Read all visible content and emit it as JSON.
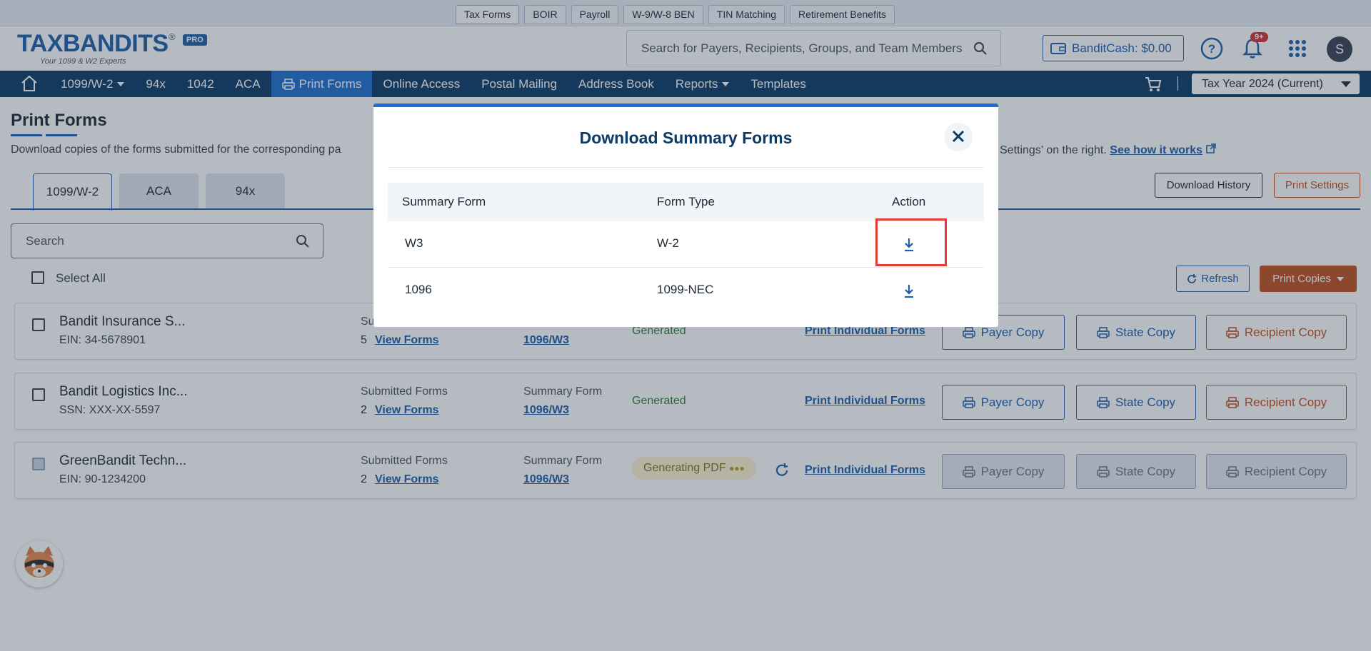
{
  "product_tabs": [
    "Tax Forms",
    "BOIR",
    "Payroll",
    "W-9/W-8 BEN",
    "TIN Matching",
    "Retirement Benefits"
  ],
  "logo": {
    "word": "TAXBANDITS",
    "tagline": "Your 1099 & W2 Experts",
    "badge": "PRO",
    "reg": "®"
  },
  "header": {
    "search_placeholder": "Search for Payers, Recipients, Groups, and Team Members",
    "bandit_cash": "BanditCash: $0.00",
    "notifications_badge": "9+",
    "avatar_initial": "S"
  },
  "nav": {
    "items": [
      "1099/W-2",
      "94x",
      "1042",
      "ACA",
      "Print Forms",
      "Online Access",
      "Postal Mailing",
      "Address Book",
      "Reports",
      "Templates"
    ],
    "tax_year": "Tax Year 2024 (Current)"
  },
  "page": {
    "title": "Print Forms",
    "description_left": "Download copies of the forms submitted for the corresponding pa",
    "description_right": "Settings' on the right.",
    "see_how": "See how it works",
    "form_tabs": [
      "1099/W-2",
      "ACA",
      "94x"
    ],
    "download_history": "Download History",
    "print_settings": "Print Settings",
    "search_placeholder": "Search",
    "select_all": "Select All",
    "refresh": "Refresh",
    "print_copies": "Print Copies"
  },
  "rows": [
    {
      "name": "Bandit Insurance S...",
      "id": "EIN: 34-5678901",
      "submitted_label": "Su",
      "count": "5",
      "view_forms": "View Forms",
      "summary_label": "",
      "summary_link": "1096/W3",
      "status": "Generated",
      "print_individual": "Print Individual Forms",
      "payer_copy": "Payer Copy",
      "state_copy": "State Copy",
      "recipient_copy": "Recipient Copy"
    },
    {
      "name": "Bandit Logistics Inc...",
      "id": "SSN: XXX-XX-5597",
      "submitted_label": "Submitted Forms",
      "count": "2",
      "view_forms": "View Forms",
      "summary_label": "Summary Form",
      "summary_link": "1096/W3",
      "status": "Generated",
      "print_individual": "Print Individual Forms",
      "payer_copy": "Payer Copy",
      "state_copy": "State Copy",
      "recipient_copy": "Recipient Copy"
    },
    {
      "name": "GreenBandit Techn...",
      "id": "EIN: 90-1234200",
      "submitted_label": "Submitted Forms",
      "count": "2",
      "view_forms": "View Forms",
      "summary_label": "Summary Form",
      "summary_link": "1096/W3",
      "status": "Generating PDF",
      "print_individual": "Print Individual Forms",
      "payer_copy": "Payer Copy",
      "state_copy": "State Copy",
      "recipient_copy": "Recipient Copy"
    }
  ],
  "modal": {
    "title": "Download Summary Forms",
    "columns": [
      "Summary Form",
      "Form Type",
      "Action"
    ],
    "rows": [
      {
        "summary_form": "W3",
        "form_type": "W-2"
      },
      {
        "summary_form": "1096",
        "form_type": "1099-NEC"
      }
    ]
  },
  "colors": {
    "brand_blue": "#1d5ea8",
    "nav_dark": "#0b3a66",
    "accent_orange": "#c0501d",
    "success_green": "#2e7d32",
    "highlight_red": "#e53935"
  }
}
